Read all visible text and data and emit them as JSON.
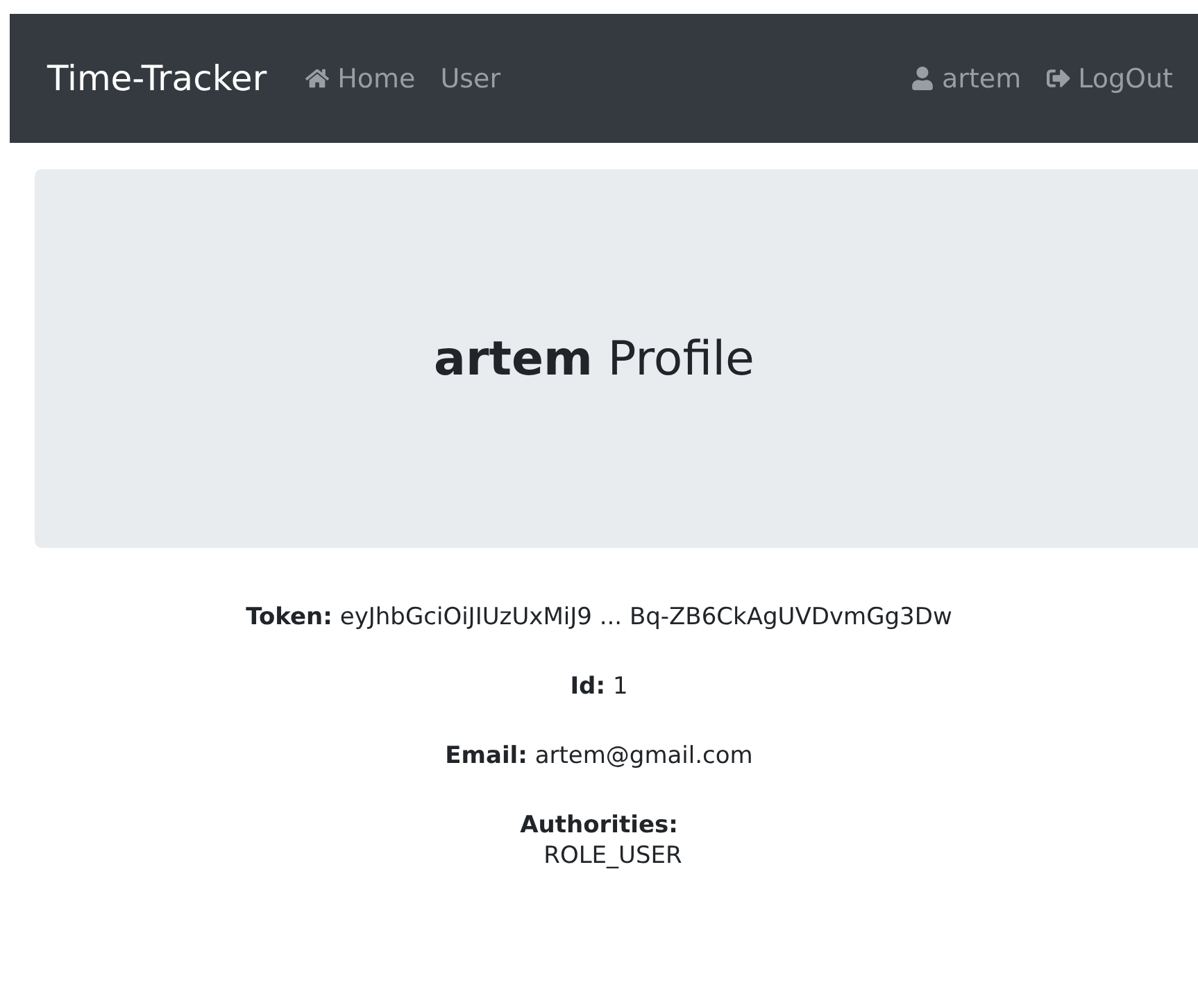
{
  "navbar": {
    "brand": "Time-Tracker",
    "links": [
      {
        "label": "Home",
        "kind": "home"
      },
      {
        "label": "User",
        "kind": "plain"
      }
    ],
    "right_links": [
      {
        "label": "artem",
        "kind": "user"
      },
      {
        "label": "LogOut",
        "kind": "logout"
      }
    ]
  },
  "header": {
    "title": "**artem** Profile"
  },
  "details": [
    {
      "label": "Token:",
      "value": "eyJhbGciOiJIUzUxMiJ9 ... Bq-ZB6CkAgUVDvmGg3Dw"
    },
    {
      "label": "Id:",
      "value": "1"
    },
    {
      "label": "Email:",
      "value": "artem@gmail.com"
    }
  ],
  "authorities": {
    "label": "Authorities:",
    "items": [
      "ROLE_USER"
    ]
  }
}
